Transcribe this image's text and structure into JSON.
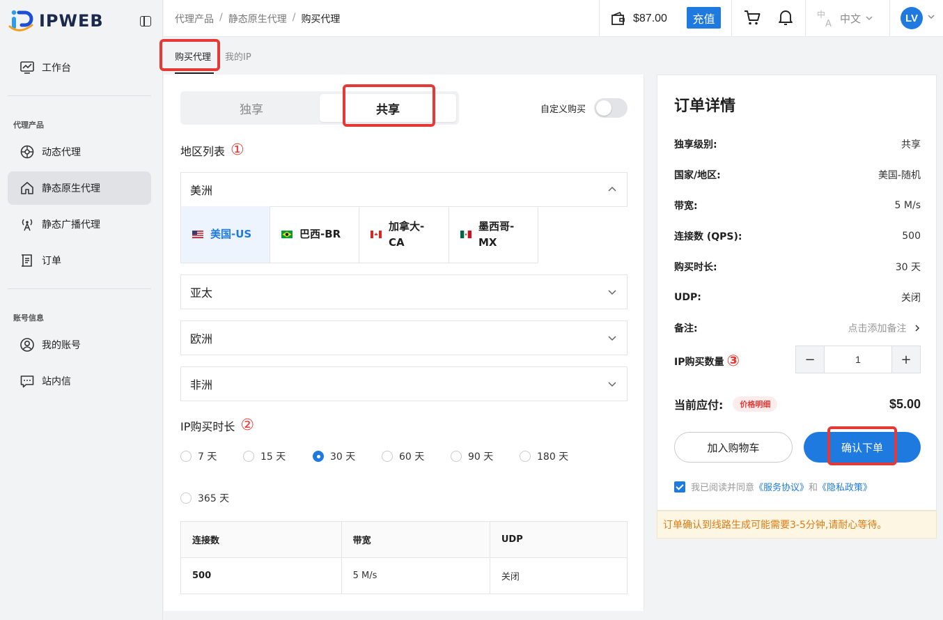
{
  "brand": {
    "name": "IPWEB"
  },
  "sidebar": {
    "top_item": {
      "label": "工作台",
      "icon": "dashboard-icon"
    },
    "sections": [
      {
        "title": "代理产品",
        "items": [
          {
            "label": "动态代理",
            "icon": "dynamic-proxy-icon"
          },
          {
            "label": "静态原生代理",
            "icon": "home-icon",
            "active": true
          },
          {
            "label": "静态广播代理",
            "icon": "antenna-icon"
          },
          {
            "label": "订单",
            "icon": "order-icon"
          }
        ]
      },
      {
        "title": "账号信息",
        "items": [
          {
            "label": "我的账号",
            "icon": "user-icon"
          },
          {
            "label": "站内信",
            "icon": "message-icon"
          }
        ]
      }
    ]
  },
  "header": {
    "breadcrumb": [
      "代理产品",
      "静态原生代理",
      "购买代理"
    ],
    "balance": "$87.00",
    "recharge": "充值",
    "language": "中文",
    "avatar": "LV"
  },
  "tabs": [
    "购买代理",
    "我的IP"
  ],
  "purchase": {
    "segment": {
      "exclusive": "独享",
      "shared": "共享",
      "selected": "共享"
    },
    "custom_buy": "自定义购买",
    "region_title": "地区列表",
    "region_marker": "①",
    "regions": [
      "美洲",
      "亚太",
      "欧洲",
      "非洲"
    ],
    "countries": [
      {
        "name": "美国-US",
        "flag": "us-flag-icon",
        "selected": true
      },
      {
        "name": "巴西-BR",
        "flag": "br-flag-icon"
      },
      {
        "name": "加拿大-CA",
        "flag": "ca-flag-icon"
      },
      {
        "name": "墨西哥-MX",
        "flag": "mx-flag-icon"
      }
    ],
    "duration_title": "IP购买时长",
    "duration_marker": "②",
    "durations": [
      "7 天",
      "15 天",
      "30 天",
      "60 天",
      "90 天",
      "180 天",
      "365 天"
    ],
    "duration_selected": "30 天",
    "spec": {
      "headers": [
        "连接数",
        "带宽",
        "UDP"
      ],
      "values": [
        "500",
        "5 M/s",
        "关闭"
      ]
    }
  },
  "order": {
    "title": "订单详情",
    "rows": [
      {
        "k": "独享级别:",
        "v": "共享"
      },
      {
        "k": "国家/地区:",
        "v": "美国-随机"
      },
      {
        "k": "带宽:",
        "v": "5 M/s"
      },
      {
        "k": "连接数 (QPS):",
        "v": "500"
      },
      {
        "k": "购买时长:",
        "v": "30 天"
      },
      {
        "k": "UDP:",
        "v": "关闭"
      }
    ],
    "note_label": "备注:",
    "note_placeholder": "点击添加备注",
    "qty_label": "IP购买数量",
    "qty_marker": "③",
    "qty_value": "1",
    "payable_label": "当前应付:",
    "price_detail": "价格明细",
    "total": "$5.00",
    "add_cart": "加入购物车",
    "confirm": "确认下单",
    "agree_text": "我已阅读并同意",
    "terms": "《服务协议》",
    "and": "和",
    "privacy": "《隐私政策》"
  },
  "notice": "订单确认到线路生成可能需要3-5分钟,请耐心等待。",
  "colors": {
    "accent": "#1f7ae0",
    "highlight": "#e53935"
  }
}
